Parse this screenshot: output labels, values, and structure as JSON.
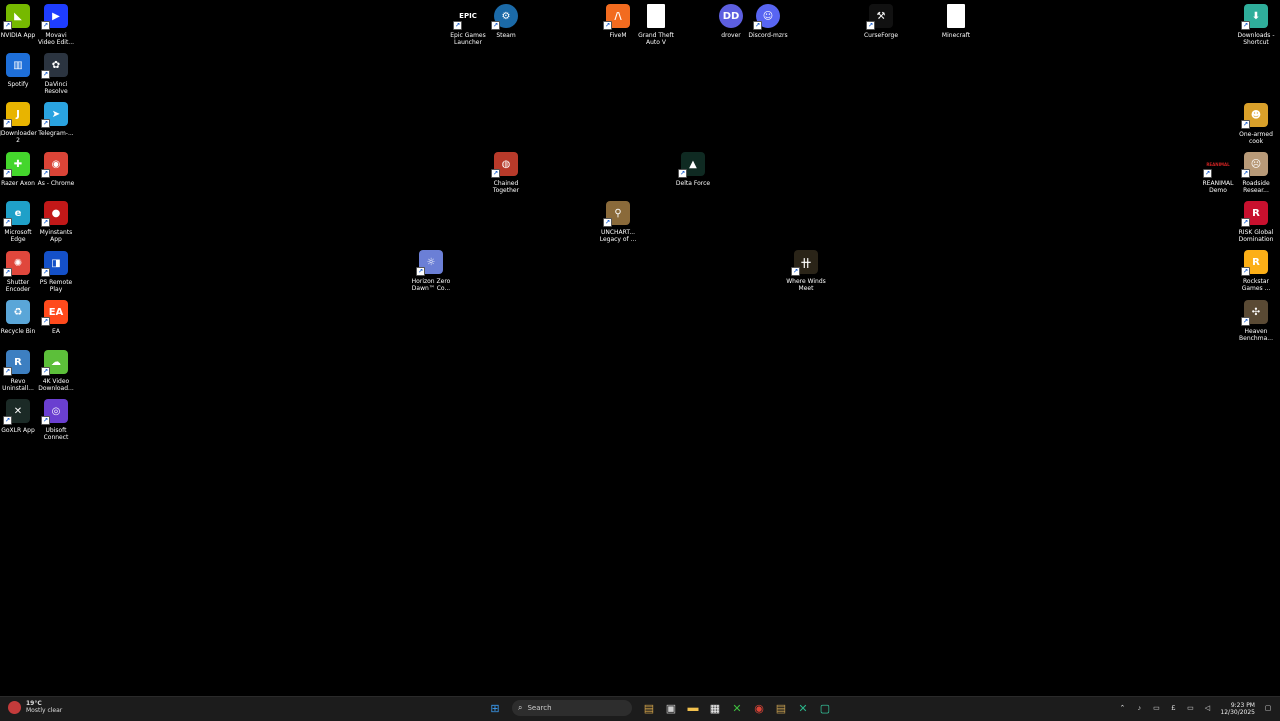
{
  "desktop_icons": [
    {
      "id": "nvidia",
      "label": "NVIDIA App",
      "color": "#76b900",
      "glyph": "◣",
      "shortcut": true
    },
    {
      "id": "movavi",
      "label": "Movavi\nVideo Edit...",
      "color": "#1e3dff",
      "glyph": "▶",
      "shortcut": true
    },
    {
      "id": "spotify",
      "label": "Spotify",
      "color": "#1e6fd9",
      "glyph": "▥",
      "shortcut": false
    },
    {
      "id": "davinci",
      "label": "DaVinci\nResolve",
      "color": "#2b3440",
      "glyph": "✿",
      "shortcut": true
    },
    {
      "id": "jdownloader",
      "label": "JDownloader\n2",
      "color": "#e8b400",
      "glyph": "J",
      "shortcut": true
    },
    {
      "id": "telegram",
      "label": "Telegram-...",
      "color": "#2aa3e0",
      "glyph": "➤",
      "shortcut": true
    },
    {
      "id": "razer",
      "label": "Razer Axon",
      "color": "#44d62c",
      "glyph": "✚",
      "shortcut": true
    },
    {
      "id": "chrome",
      "label": "As - Chrome",
      "color": "#db4437",
      "glyph": "◉",
      "shortcut": true
    },
    {
      "id": "edge",
      "label": "Microsoft\nEdge",
      "color": "#1fa0c8",
      "glyph": "e",
      "shortcut": true
    },
    {
      "id": "myinstants",
      "label": "Myinstants\nApp",
      "color": "#c21818",
      "glyph": "●",
      "shortcut": true
    },
    {
      "id": "shutter",
      "label": "Shutter\nEncoder",
      "color": "#e0473c",
      "glyph": "✺",
      "shortcut": true
    },
    {
      "id": "psremote",
      "label": "PS Remote\nPlay",
      "color": "#1450c8",
      "glyph": "◨",
      "shortcut": true
    },
    {
      "id": "recycle",
      "label": "Recycle Bin",
      "color": "#5aa6d8",
      "glyph": "♻",
      "shortcut": false
    },
    {
      "id": "ea",
      "label": "EA",
      "color": "#ff4a1c",
      "glyph": "EA",
      "shortcut": true
    },
    {
      "id": "revo",
      "label": "Revo\nUninstall...",
      "color": "#3d7fc1",
      "glyph": "R",
      "shortcut": true
    },
    {
      "id": "4kvideo",
      "label": "4K Video\nDownload...",
      "color": "#5cbf3a",
      "glyph": "☁",
      "shortcut": true
    },
    {
      "id": "goxlr",
      "label": "GoXLR App",
      "color": "#1b2a26",
      "glyph": "✕",
      "shortcut": true
    },
    {
      "id": "ubisoft",
      "label": "Ubisoft\nConnect",
      "color": "#6a3fd0",
      "glyph": "◎",
      "shortcut": true
    },
    {
      "id": "epic",
      "label": "Epic Games\nLauncher",
      "color": "#2a2a2a",
      "glyph": "EPIC",
      "shortcut": true
    },
    {
      "id": "steam",
      "label": "Steam",
      "color": "#1b6aa8",
      "glyph": "⚙",
      "shortcut": true
    },
    {
      "id": "fivem",
      "label": "FiveM",
      "color": "#f26b1f",
      "glyph": "/\\",
      "shortcut": true
    },
    {
      "id": "gta",
      "label": "Grand Theft\nAuto V",
      "color": "#ffffff",
      "glyph": "",
      "shortcut": false
    },
    {
      "id": "drover",
      "label": "drover",
      "color": "#5d5fe0",
      "glyph": "DD",
      "shortcut": false
    },
    {
      "id": "discord",
      "label": "Discord-mzrs",
      "color": "#5865f2",
      "glyph": "☺",
      "shortcut": true
    },
    {
      "id": "curseforge",
      "label": "CurseForge",
      "color": "#111111",
      "glyph": "⚒",
      "shortcut": true
    },
    {
      "id": "minecraft",
      "label": "Minecraft",
      "color": "#ffffff",
      "glyph": "",
      "shortcut": false
    },
    {
      "id": "downloads",
      "label": "Downloads -\nShortcut",
      "color": "#2fae9b",
      "glyph": "⬇",
      "shortcut": true
    },
    {
      "id": "onearmed",
      "label": "One-armed\ncook",
      "color": "#d9a02a",
      "glyph": "☻",
      "shortcut": true
    },
    {
      "id": "chained",
      "label": "Chained\nTogether",
      "color": "#b83a2a",
      "glyph": "◍",
      "shortcut": true
    },
    {
      "id": "deltaforce",
      "label": "Delta Force",
      "color": "#0f2a22",
      "glyph": "▲",
      "shortcut": true
    },
    {
      "id": "reanimal",
      "label": "REANIMAL\nDemo",
      "color": "#6a0c0c",
      "glyph": "REANIMAL",
      "shortcut": true
    },
    {
      "id": "roadside",
      "label": "Roadside\nResear...",
      "color": "#b89a78",
      "glyph": "☹",
      "shortcut": true
    },
    {
      "id": "uncharted",
      "label": "UNCHART...\nLegacy of ...",
      "color": "#8a6a3a",
      "glyph": "⚲",
      "shortcut": true
    },
    {
      "id": "risk",
      "label": "RISK Global\nDomination",
      "color": "#c8102e",
      "glyph": "R",
      "shortcut": true
    },
    {
      "id": "horizon",
      "label": "Horizon Zero\nDawn™ Co...",
      "color": "#6b7fd6",
      "glyph": "☼",
      "shortcut": true
    },
    {
      "id": "wherewinds",
      "label": "Where Winds\nMeet",
      "color": "#2a2418",
      "glyph": "卄",
      "shortcut": true
    },
    {
      "id": "rockstar",
      "label": "Rockstar\nGames ...",
      "color": "#fcaf17",
      "glyph": "R",
      "shortcut": true
    },
    {
      "id": "heaven",
      "label": "Heaven\nBenchma...",
      "color": "#5a4a34",
      "glyph": "✣",
      "shortcut": true
    }
  ],
  "taskbar": {
    "weather": {
      "temp": "19°C",
      "desc": "Mostly clear"
    },
    "search_placeholder": "Search",
    "pinned": [
      {
        "id": "start",
        "icon": "windows-logo",
        "color": "#3a9bf0",
        "glyph": "⊞"
      },
      {
        "id": "files",
        "icon": "file-manager",
        "color": "#d6a64a",
        "glyph": "▤"
      },
      {
        "id": "taskview",
        "icon": "task-view",
        "color": "#cfcfcf",
        "glyph": "▣"
      },
      {
        "id": "explorer",
        "icon": "folder",
        "color": "#f2c14e",
        "glyph": "▬"
      },
      {
        "id": "store",
        "icon": "store",
        "color": "#ffffff",
        "glyph": "▦"
      },
      {
        "id": "xbox",
        "icon": "xbox",
        "color": "#3fbf3f",
        "glyph": "✕"
      },
      {
        "id": "chrome",
        "icon": "chrome",
        "color": "#db4437",
        "glyph": "◉"
      },
      {
        "id": "archive",
        "icon": "archive",
        "color": "#c8a050",
        "glyph": "▤"
      },
      {
        "id": "goxlr",
        "icon": "goxlr",
        "color": "#2ab58a",
        "glyph": "✕"
      },
      {
        "id": "app",
        "icon": "app",
        "color": "#37d6a8",
        "glyph": "▢"
      }
    ],
    "tray": {
      "keyboard": "£",
      "time": "9:23 PM",
      "date": "12/30/2025"
    }
  }
}
